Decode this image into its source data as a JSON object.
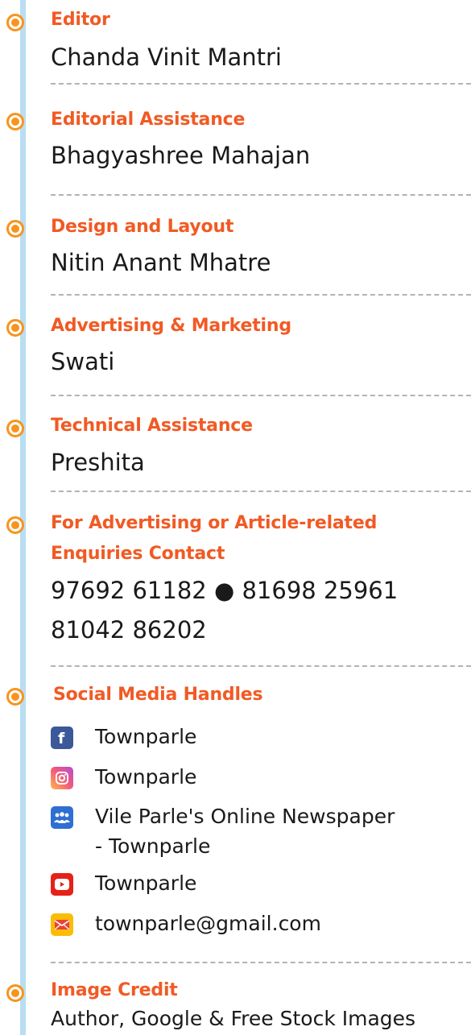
{
  "credits": [
    {
      "label": "Editor",
      "value": "Chanda Vinit Mantri"
    },
    {
      "label": "Editorial Assistance",
      "value": "Bhagyashree Mahajan"
    },
    {
      "label": "Design and Layout",
      "value": "Nitin Anant Mhatre"
    },
    {
      "label": "Advertising & Marketing",
      "value": "Swati"
    },
    {
      "label": "Technical Assistance",
      "value": "Preshita"
    }
  ],
  "contact": {
    "label_line1": "For Advertising or Article-related",
    "label_line2": "Enquiries Contact",
    "phones_line1": "97692 61182 ● 81698 25961",
    "phones_line2": "81042 86202"
  },
  "social": {
    "label": "Social Media Handles",
    "items": [
      {
        "icon": "facebook-icon",
        "text": "Townparle"
      },
      {
        "icon": "instagram-icon",
        "text": "Townparle"
      },
      {
        "icon": "group-icon",
        "text": "Vile Parle's Online Newspaper",
        "text2": "- Townparle"
      },
      {
        "icon": "youtube-icon",
        "text": "Townparle"
      },
      {
        "icon": "mail-icon",
        "text": "townparle@gmail.com"
      }
    ]
  },
  "image_credit": {
    "label": "Image Credit",
    "value": "Author, Google & Free Stock Images"
  },
  "colors": {
    "accent": "#f15a24",
    "dot": "#f7941d",
    "timeline": "#b9def3",
    "divider": "#b3b3b3"
  }
}
